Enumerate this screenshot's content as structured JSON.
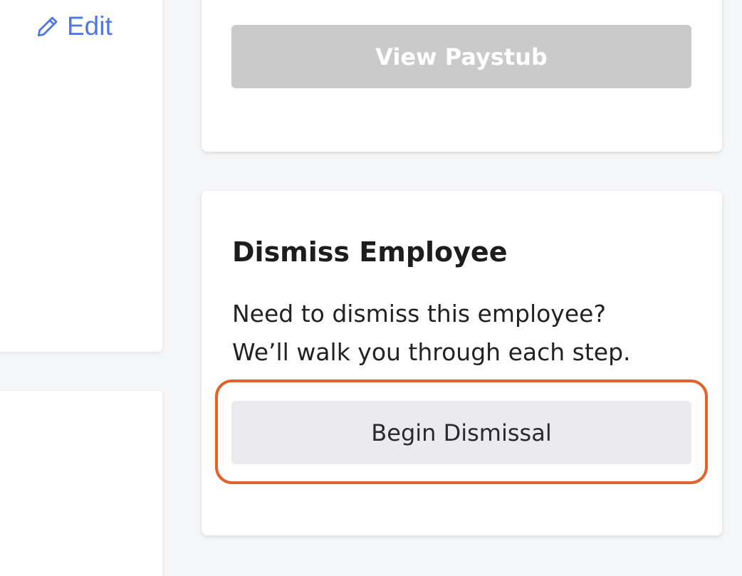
{
  "edit_link": {
    "label": "Edit",
    "icon": "pencil-icon"
  },
  "paystub": {
    "button_label": "View Paystub"
  },
  "dismiss": {
    "title": "Dismiss Employee",
    "description_line1": "Need to dismiss this employee?",
    "description_line2": "We’ll walk you through each step.",
    "button_label": "Begin Dismissal"
  },
  "colors": {
    "link": "#4f79e0",
    "disabled_button": "#cacaca",
    "secondary_button": "#ebebef",
    "highlight": "#e0622c"
  }
}
